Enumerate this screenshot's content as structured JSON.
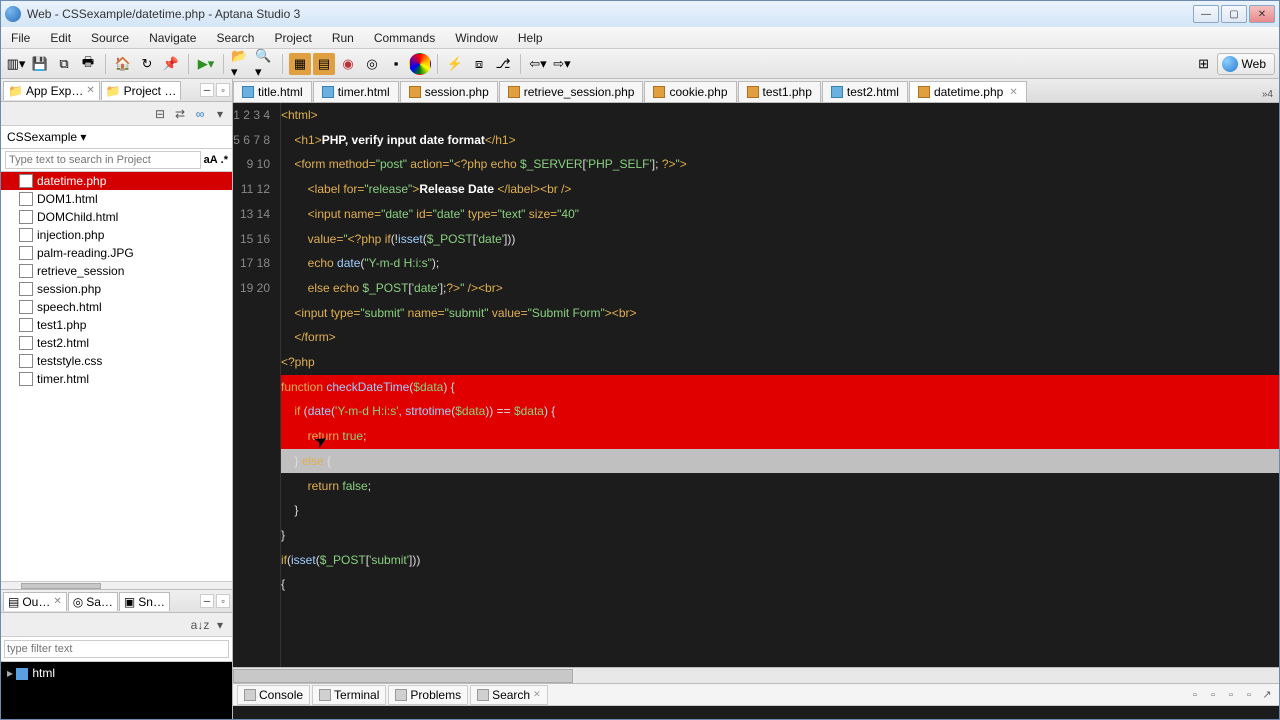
{
  "window": {
    "title": "Web - CSSexample/datetime.php - Aptana Studio 3"
  },
  "menubar": [
    "File",
    "Edit",
    "Source",
    "Navigate",
    "Search",
    "Project",
    "Run",
    "Commands",
    "Window",
    "Help"
  ],
  "perspective": {
    "label": "Web"
  },
  "left": {
    "tabs": {
      "app_explorer": "App Exp…",
      "project": "Project …"
    },
    "project_name": "CSSexample",
    "search_placeholder": "Type text to search in Project",
    "files": [
      {
        "name": "datetime.php",
        "sel": true
      },
      {
        "name": "DOM1.html"
      },
      {
        "name": "DOMChild.html"
      },
      {
        "name": "injection.php"
      },
      {
        "name": "palm-reading.JPG"
      },
      {
        "name": "retrieve_session"
      },
      {
        "name": "session.php"
      },
      {
        "name": "speech.html"
      },
      {
        "name": "test1.php"
      },
      {
        "name": "test2.html"
      },
      {
        "name": "teststyle.css"
      },
      {
        "name": "timer.html"
      }
    ],
    "bottom_tabs": {
      "outline": "Ou…",
      "samples": "Sa…",
      "snippets": "Sn…"
    },
    "outline_filter_placeholder": "type filter text",
    "outline_root": "html"
  },
  "editor_tabs": [
    {
      "name": "title.html",
      "kind": "html"
    },
    {
      "name": "timer.html",
      "kind": "html"
    },
    {
      "name": "session.php",
      "kind": "php"
    },
    {
      "name": "retrieve_session.php",
      "kind": "php"
    },
    {
      "name": "cookie.php",
      "kind": "php"
    },
    {
      "name": "test1.php",
      "kind": "php"
    },
    {
      "name": "test2.html",
      "kind": "html"
    },
    {
      "name": "datetime.php",
      "kind": "php",
      "active": true
    }
  ],
  "editor_more": "»4",
  "code": {
    "lines": 20,
    "highlight_red": {
      "from": 12,
      "to": 14
    },
    "highlight_cursor": 15
  },
  "bottom_panel": {
    "tabs": [
      "Console",
      "Terminal",
      "Problems",
      "Search"
    ],
    "active_idx": 3
  }
}
